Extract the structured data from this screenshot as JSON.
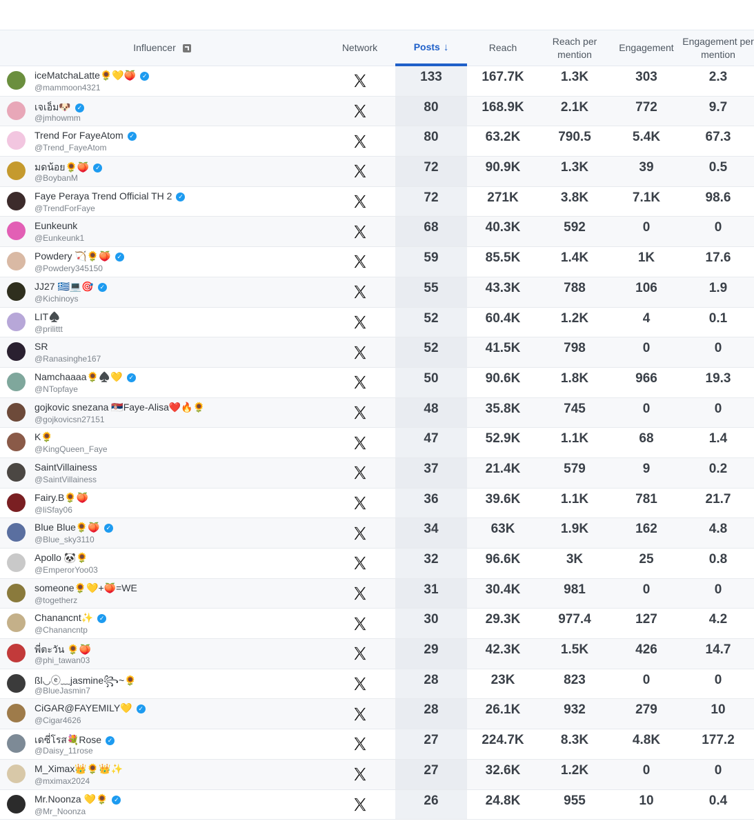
{
  "header": {
    "influencer": "Influencer",
    "network": "Network",
    "posts": "Posts",
    "reach": "Reach",
    "reach_per_mention_1": "Reach per",
    "reach_per_mention_2": "mention",
    "engagement": "Engagement",
    "engagement_per_mention_1": "Engagement per",
    "engagement_per_mention_2": "mention"
  },
  "network_icon": "x-logo-icon",
  "colors": {
    "accent": "#1f60c9",
    "verified": "#1d9bf0"
  },
  "rows": [
    {
      "name": "iceMatchaLatte🌻💛🍑",
      "handle": "@mammoon4321",
      "verified": true,
      "posts": "133",
      "reach": "167.7K",
      "rpm": "1.3K",
      "engagement": "303",
      "epm": "2.3",
      "avatar_color": "#6b8f3e"
    },
    {
      "name": "เจเอ็ม🐶",
      "handle": "@jmhowmm",
      "verified": true,
      "posts": "80",
      "reach": "168.9K",
      "rpm": "2.1K",
      "engagement": "772",
      "epm": "9.7",
      "avatar_color": "#e8a7b8"
    },
    {
      "name": "Trend For FayeAtom",
      "handle": "@Trend_FayeAtom",
      "verified": true,
      "posts": "80",
      "reach": "63.2K",
      "rpm": "790.5",
      "engagement": "5.4K",
      "epm": "67.3",
      "avatar_color": "#f2c6e0"
    },
    {
      "name": "มดน้อย🌻🍑",
      "handle": "@BoybanM",
      "verified": true,
      "posts": "72",
      "reach": "90.9K",
      "rpm": "1.3K",
      "engagement": "39",
      "epm": "0.5",
      "avatar_color": "#c59a2e"
    },
    {
      "name": "Faye Peraya Trend Official TH 2",
      "handle": "@TrendForFaye",
      "verified": true,
      "posts": "72",
      "reach": "271K",
      "rpm": "3.8K",
      "engagement": "7.1K",
      "epm": "98.6",
      "avatar_color": "#3c2b2b"
    },
    {
      "name": "Eunkeunk",
      "handle": "@Eunkeunk1",
      "verified": false,
      "posts": "68",
      "reach": "40.3K",
      "rpm": "592",
      "engagement": "0",
      "epm": "0",
      "avatar_color": "#e25fb5"
    },
    {
      "name": "Powdery 🏹🌻🍑",
      "handle": "@Powdery345150",
      "verified": true,
      "posts": "59",
      "reach": "85.5K",
      "rpm": "1.4K",
      "engagement": "1K",
      "epm": "17.6",
      "avatar_color": "#d9b9a4"
    },
    {
      "name": "JJ27 🇬🇷💻🎯",
      "handle": "@Kichinoys",
      "verified": true,
      "posts": "55",
      "reach": "43.3K",
      "rpm": "788",
      "engagement": "106",
      "epm": "1.9",
      "avatar_color": "#2f2f1e"
    },
    {
      "name": "LIT♠️",
      "handle": "@prilittt",
      "verified": false,
      "posts": "52",
      "reach": "60.4K",
      "rpm": "1.2K",
      "engagement": "4",
      "epm": "0.1",
      "avatar_color": "#b7a7d8"
    },
    {
      "name": "SR",
      "handle": "@Ranasinghe167",
      "verified": false,
      "posts": "52",
      "reach": "41.5K",
      "rpm": "798",
      "engagement": "0",
      "epm": "0",
      "avatar_color": "#2a2030"
    },
    {
      "name": "Namchaaaa🌻♠️💛",
      "handle": "@NTopfaye",
      "verified": true,
      "posts": "50",
      "reach": "90.6K",
      "rpm": "1.8K",
      "engagement": "966",
      "epm": "19.3",
      "avatar_color": "#7fa79c"
    },
    {
      "name": "gojkovic snezana 🇷🇸Faye-Alisa❤️🔥🌻",
      "handle": "@gojkovicsn27151",
      "verified": false,
      "posts": "48",
      "reach": "35.8K",
      "rpm": "745",
      "engagement": "0",
      "epm": "0",
      "avatar_color": "#6d4a3a"
    },
    {
      "name": "K🌻",
      "handle": "@KingQueen_Faye",
      "verified": false,
      "posts": "47",
      "reach": "52.9K",
      "rpm": "1.1K",
      "engagement": "68",
      "epm": "1.4",
      "avatar_color": "#8a5a48"
    },
    {
      "name": "SaintVillainess",
      "handle": "@SaintVillainess",
      "verified": false,
      "posts": "37",
      "reach": "21.4K",
      "rpm": "579",
      "engagement": "9",
      "epm": "0.2",
      "avatar_color": "#4b4743"
    },
    {
      "name": "Fairy.B🌻🍑",
      "handle": "@liSfay06",
      "verified": false,
      "posts": "36",
      "reach": "39.6K",
      "rpm": "1.1K",
      "engagement": "781",
      "epm": "21.7",
      "avatar_color": "#7a1f22"
    },
    {
      "name": "Blue Blue🌻🍑",
      "handle": "@Blue_sky3110",
      "verified": true,
      "posts": "34",
      "reach": "63K",
      "rpm": "1.9K",
      "engagement": "162",
      "epm": "4.8",
      "avatar_color": "#5a6fa0"
    },
    {
      "name": "Apollo 🐼🌻",
      "handle": "@EmperorYoo03",
      "verified": false,
      "posts": "32",
      "reach": "96.6K",
      "rpm": "3K",
      "engagement": "25",
      "epm": "0.8",
      "avatar_color": "#c9c9c9"
    },
    {
      "name": "someone🌻💛+🍑=WE",
      "handle": "@togetherz",
      "verified": false,
      "posts": "31",
      "reach": "30.4K",
      "rpm": "981",
      "engagement": "0",
      "epm": "0",
      "avatar_color": "#8a7a3c"
    },
    {
      "name": "Chanancnt✨",
      "handle": "@Chanancntp",
      "verified": true,
      "posts": "30",
      "reach": "29.3K",
      "rpm": "977.4",
      "engagement": "127",
      "epm": "4.2",
      "avatar_color": "#c4b089"
    },
    {
      "name": "พี่ตะวัน 🌻🍑",
      "handle": "@phi_tawan03",
      "verified": false,
      "posts": "29",
      "reach": "42.3K",
      "rpm": "1.5K",
      "engagement": "426",
      "epm": "14.7",
      "avatar_color": "#c23a3a"
    },
    {
      "name": "ßl◡ⓔ﹏jasmine꧂~🌻",
      "handle": "@BlueJasmin7",
      "verified": false,
      "posts": "28",
      "reach": "23K",
      "rpm": "823",
      "engagement": "0",
      "epm": "0",
      "avatar_color": "#3b3b3b"
    },
    {
      "name": "CiGAR@FAYEMILY💛",
      "handle": "@Cigar4626",
      "verified": true,
      "posts": "28",
      "reach": "26.1K",
      "rpm": "932",
      "engagement": "279",
      "epm": "10",
      "avatar_color": "#9e7b4a"
    },
    {
      "name": "เดซี่โรส💐Rose",
      "handle": "@Daisy_11rose",
      "verified": true,
      "posts": "27",
      "reach": "224.7K",
      "rpm": "8.3K",
      "engagement": "4.8K",
      "epm": "177.2",
      "avatar_color": "#7d8a96"
    },
    {
      "name": "M_Ximax👑🌻👑✨",
      "handle": "@mximax2024",
      "verified": false,
      "posts": "27",
      "reach": "32.6K",
      "rpm": "1.2K",
      "engagement": "0",
      "epm": "0",
      "avatar_color": "#d8c8a8"
    },
    {
      "name": "Mr.Noonza 💛🌻",
      "handle": "@Mr_Noonza",
      "verified": true,
      "posts": "26",
      "reach": "24.8K",
      "rpm": "955",
      "engagement": "10",
      "epm": "0.4",
      "avatar_color": "#2b2b2b"
    }
  ]
}
